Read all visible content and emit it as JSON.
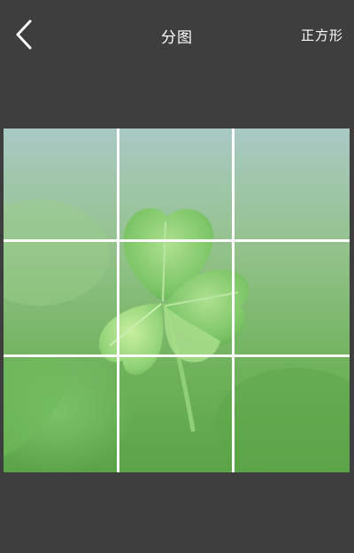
{
  "header": {
    "back_icon": "chevron-left-icon",
    "title": "分图",
    "aspect_label": "正方形"
  },
  "photo": {
    "subject": "four-leaf-clover-photo",
    "grid_rows": 3,
    "grid_cols": 3
  },
  "colors": {
    "background": "#3e3e3e",
    "grid_line": "#ffffff",
    "text": "#ffffff"
  }
}
